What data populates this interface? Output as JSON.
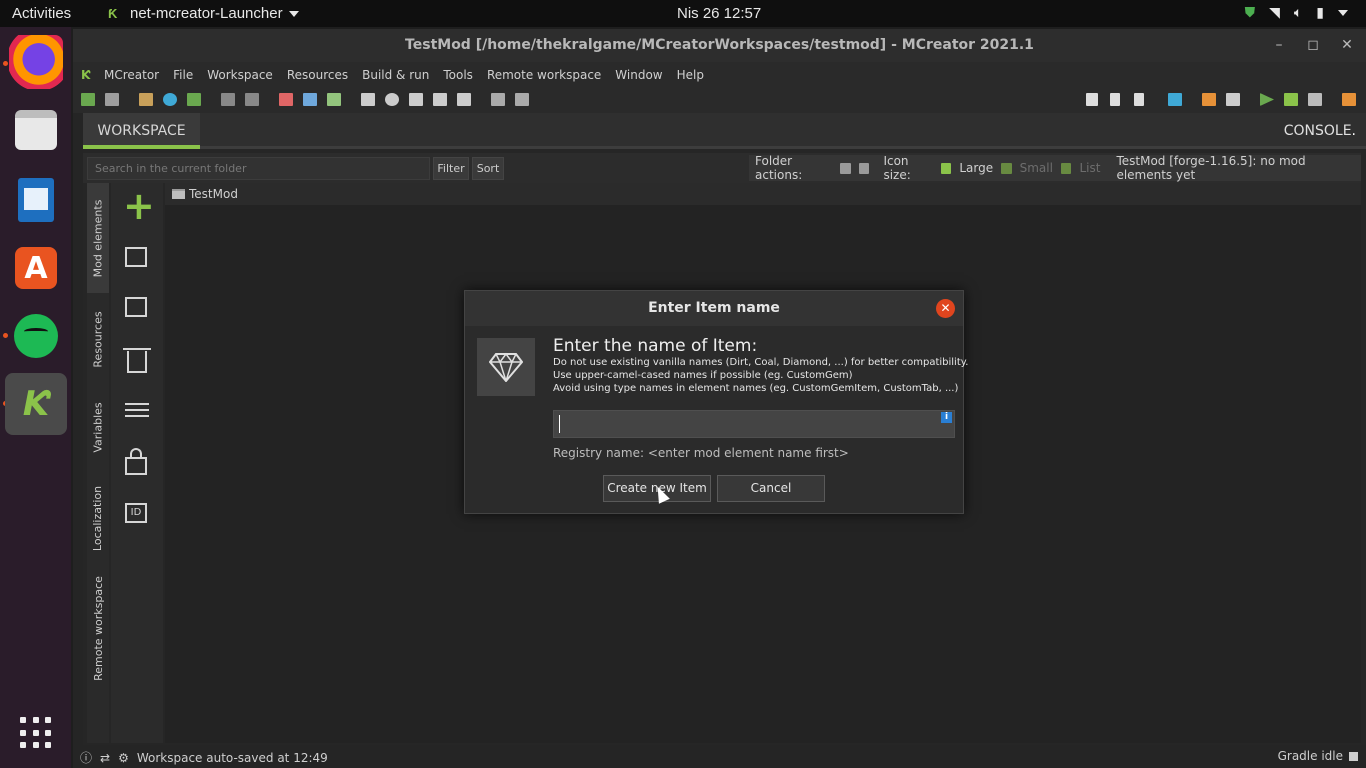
{
  "topbar": {
    "activities": "Activities",
    "app_name": "net-mcreator-Launcher",
    "clock": "Nis 26  12:57"
  },
  "window": {
    "title": "TestMod [/home/thekralgame/MCreatorWorkspaces/testmod]  - MCreator 2021.1"
  },
  "menu": {
    "items": [
      "MCreator",
      "File",
      "Workspace",
      "Resources",
      "Build & run",
      "Tools",
      "Remote workspace",
      "Window",
      "Help"
    ]
  },
  "tabs": {
    "workspace": "WORKSPACE",
    "console": "CONSOLE"
  },
  "filterbar": {
    "search_placeholder": "Search in the current folder",
    "filter": "Filter",
    "sort": "Sort",
    "folder_actions": "Folder actions:",
    "icon_size": "Icon size:",
    "large": "Large",
    "small": "Small",
    "list": "List",
    "workspace_info": "TestMod [forge-1.16.5]: no mod elements yet"
  },
  "sidetabs": [
    "Mod elements",
    "Resources",
    "Variables",
    "Localization",
    "Remote workspace"
  ],
  "folder": {
    "name": "TestMod"
  },
  "status": {
    "autosave": "Workspace auto-saved at 12:49",
    "gradle": "Gradle idle"
  },
  "dialog": {
    "title": "Enter Item name",
    "heading": "Enter the name of Item:",
    "hints": [
      "Do not use existing vanilla names (Dirt, Coal, Diamond, ...) for better compatibility.",
      "Use upper-camel-cased names if possible (eg. CustomGem)",
      "Avoid using type names in element names (eg. CustomGemItem, CustomTab, ...)"
    ],
    "input_value": "",
    "registry": "Registry name: <enter mod element name first>",
    "create_button": "Create new Item",
    "cancel_button": "Cancel"
  },
  "colors": {
    "accent": "#8bc34a",
    "close_red": "#e0451e",
    "ubuntu_orange": "#e95420",
    "info_blue": "#2a7fd4"
  }
}
